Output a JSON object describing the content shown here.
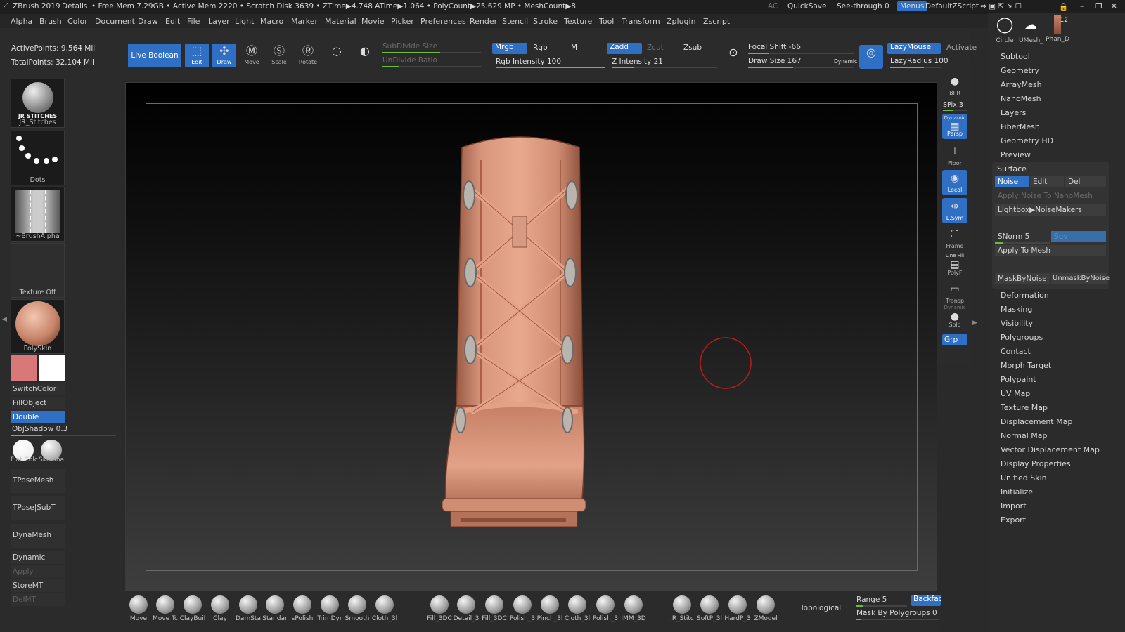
{
  "titlebar": {
    "app": "ZBrush 2019",
    "details": "Details",
    "stats": "• Free Mem 7.29GB • Active Mem 2220 • Scratch Disk 3639 • ZTime▶4.748 ATime▶1.064 • PolyCount▶25.629 MP • MeshCount▶8",
    "ac": "AC",
    "quicksave": "QuickSave",
    "seethrough": "See-through",
    "seethrough_value": "0",
    "menus": "Menus",
    "default_zscript": "DefaultZScript"
  },
  "menubar": [
    "Alpha",
    "Brush",
    "Color",
    "Document",
    "Draw",
    "Edit",
    "File",
    "Layer",
    "Light",
    "Macro",
    "Marker",
    "Material",
    "Movie",
    "Picker",
    "Preferences",
    "Render",
    "Stencil",
    "Stroke",
    "Texture",
    "Tool",
    "Transform",
    "Zplugin",
    "Zscript"
  ],
  "topshelf": {
    "active_points": "ActivePoints: 9.564 Mil",
    "total_points": "TotalPoints: 32.104 Mil",
    "live_boolean": "Live Boolean",
    "tools": [
      "Edit",
      "Draw",
      "Move",
      "Scale",
      "Rotate"
    ],
    "subdivide_size": "SubDivide Size",
    "undivide_ratio": "UnDivide Ratio",
    "mrgb": "Mrgb",
    "rgb": "Rgb",
    "m": "M",
    "rgb_intensity": "Rgb Intensity 100",
    "rgb_intensity_value": 100,
    "zadd": "Zadd",
    "zsub": "Zsub",
    "zcut": "Zcut",
    "z_intensity": "Z Intensity 21",
    "z_intensity_value": 21,
    "focal_shift": "Focal Shift -66",
    "draw_size": "Draw Size 167",
    "dynamic": "Dynamic",
    "lazy_mouse": "LazyMouse",
    "lazy_radius": "LazyRadius 100",
    "activate": "Activate"
  },
  "leftpal": {
    "brush_name": "JR_Stitches",
    "brush_thumb_label": "JR STITCHES",
    "stroke_name": "Dots",
    "alpha_name": "~BrushAlpha",
    "texture_name": "Texture Off",
    "material_name": "PolySkin",
    "switch_color": "SwitchColor",
    "fill_object": "FillObject",
    "double": "Double",
    "obj_shadow": "ObjShadow 0.3",
    "obj_shadow_value": 0.3,
    "flat_color": "Flat Colc",
    "skin_shade": "SkinSha",
    "tpose_mesh": "TPoseMesh",
    "tpose_subt": "TPose|SubT",
    "dynamesh": "DynaMesh",
    "dynamic": "Dynamic",
    "apply": "Apply",
    "store_mt": "StoreMT",
    "del_mt": "DelMT",
    "main_color": "#d87878",
    "secondary_color": "#ffffff"
  },
  "rightcol": {
    "bpr": "BPR",
    "spix": "SPix 3",
    "persp": "Persp",
    "persp_top": "Dynamic",
    "floor": "Floor",
    "local": "Local",
    "lsym": "L.Sym",
    "frame": "Frame",
    "linefill": "Line Fill",
    "polyf": "PolyF",
    "transp": "Transp",
    "solo_top": "Dynamic",
    "solo": "Solo",
    "grp": "Grp"
  },
  "rightpal": {
    "top_tools": [
      "Circle",
      "UMesh_",
      "Phan_D"
    ],
    "top_count": "12",
    "items_top": [
      "Subtool",
      "Geometry",
      "ArrayMesh",
      "NanoMesh",
      "Layers",
      "FiberMesh",
      "Geometry HD",
      "Preview"
    ],
    "surface": {
      "title": "Surface",
      "noise": "Noise",
      "edit": "Edit",
      "del": "Del",
      "apply_nano": "Apply Noise To NanoMesh",
      "lightbox": "Lightbox▶NoiseMakers",
      "snorm": "SNorm 5",
      "suv": "Suv",
      "apply_mesh": "Apply To Mesh",
      "mask_by_noise": "MaskByNoise",
      "unmask_by_noise": "UnmaskByNoise"
    },
    "items_bottom": [
      "Deformation",
      "Masking",
      "Visibility",
      "Polygroups",
      "Contact",
      "Morph Target",
      "Polypaint",
      "UV Map",
      "Texture Map",
      "Displacement Map",
      "Normal Map",
      "Vector Displacement Map",
      "Display Properties",
      "Unified Skin",
      "Initialize",
      "Import",
      "Export"
    ]
  },
  "bottomshelf": {
    "brushes": [
      "Move",
      "Move Tc",
      "ClayBuil",
      "Clay",
      "DamSta",
      "Standar",
      "sPolish",
      "TrimDyr",
      "Smooth",
      "Cloth_3l",
      "Fill_3DC",
      "Detail_3",
      "Fill_3DC",
      "Polish_3",
      "Pinch_3l",
      "Cloth_3l",
      "Polish_3",
      "IMM_3D",
      "JR_Stitc",
      "SoftP_3l",
      "HardP_3",
      "ZModel"
    ],
    "topological": "Topological",
    "range": "Range 5",
    "range_value": 5,
    "backface": "Backfac",
    "mask_by_polygroups": "Mask By Polygroups 0"
  },
  "colors": {
    "accent": "#2f6fc4",
    "slider_fill": "#6dbb3d",
    "skin": "#c8846a"
  }
}
